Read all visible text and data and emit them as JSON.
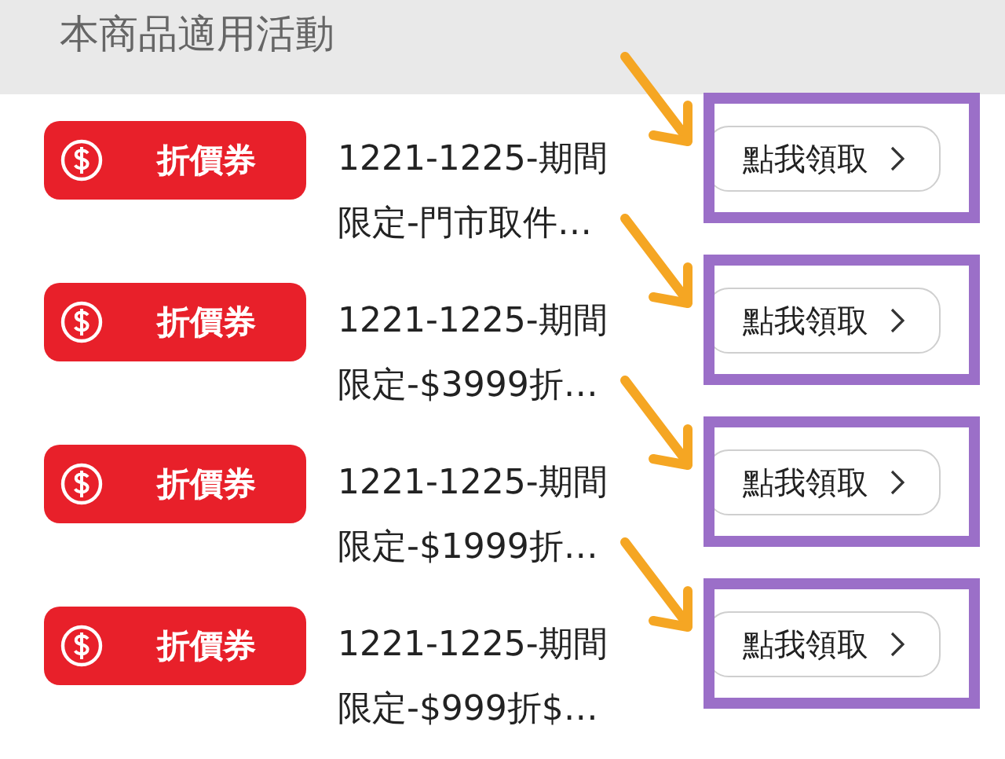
{
  "header": {
    "title": "本商品適用活動"
  },
  "coupons": [
    {
      "badge": "折價券",
      "lines": [
        "1221-1225-期間",
        "限定-門市取件…"
      ],
      "button": "點我領取",
      "highlighted": true
    },
    {
      "badge": "折價券",
      "lines": [
        "1221-1225-期間",
        "限定-$3999折…"
      ],
      "button": "點我領取",
      "highlighted": true
    },
    {
      "badge": "折價券",
      "lines": [
        "1221-1225-期間",
        "限定-$1999折…"
      ],
      "button": "點我領取",
      "highlighted": true
    },
    {
      "badge": "折價券",
      "lines": [
        "1221-1225-期間",
        "限定-$999折$…"
      ],
      "button": "點我領取",
      "highlighted": true
    }
  ]
}
